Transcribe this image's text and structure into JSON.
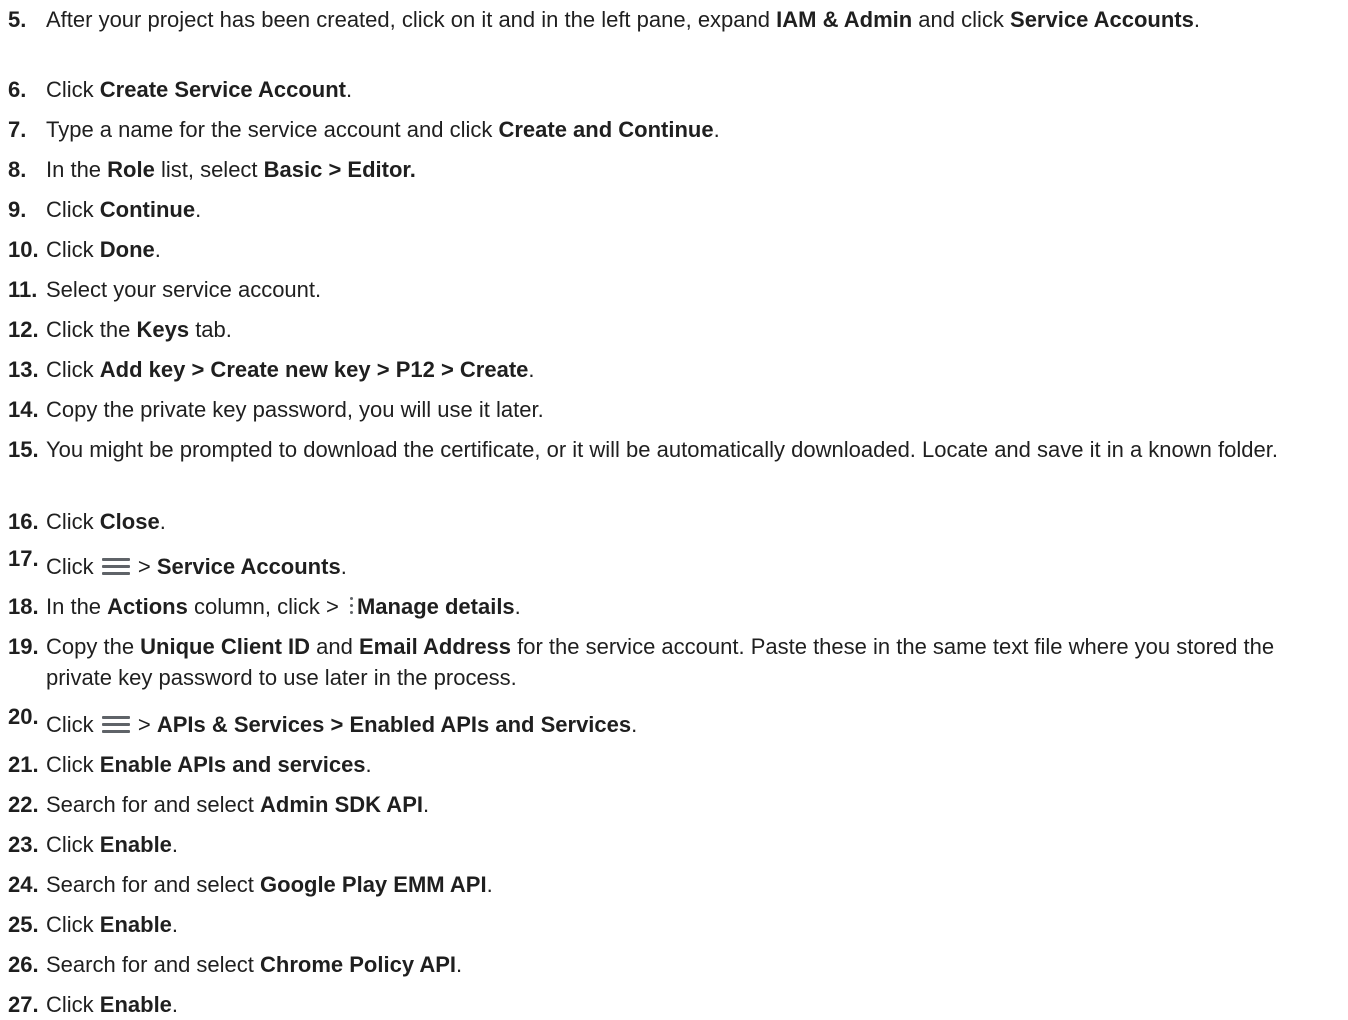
{
  "steps": [
    {
      "num": "5.",
      "parts": [
        {
          "t": "After your project has been created, click on it and in the left pane, expand "
        },
        {
          "t": "IAM & Admin",
          "b": true
        },
        {
          "t": " and click "
        },
        {
          "t": "Service Accounts",
          "b": true
        },
        {
          "t": "."
        }
      ]
    },
    {
      "num": "6.",
      "parts": [
        {
          "t": "Click "
        },
        {
          "t": "Create Service Account",
          "b": true
        },
        {
          "t": "."
        }
      ]
    },
    {
      "num": "7.",
      "parts": [
        {
          "t": "Type a name for the service account and click "
        },
        {
          "t": "Create and Continue",
          "b": true
        },
        {
          "t": "."
        }
      ]
    },
    {
      "num": "8.",
      "parts": [
        {
          "t": "In the "
        },
        {
          "t": "Role",
          "b": true
        },
        {
          "t": " list, select "
        },
        {
          "t": "Basic > Editor.",
          "b": true
        }
      ]
    },
    {
      "num": "9.",
      "parts": [
        {
          "t": "Click "
        },
        {
          "t": "Continue",
          "b": true
        },
        {
          "t": "."
        }
      ]
    },
    {
      "num": "10.",
      "parts": [
        {
          "t": "Click "
        },
        {
          "t": "Done",
          "b": true
        },
        {
          "t": "."
        }
      ]
    },
    {
      "num": "11.",
      "parts": [
        {
          "t": "Select your service account."
        }
      ]
    },
    {
      "num": "12.",
      "parts": [
        {
          "t": "Click the "
        },
        {
          "t": "Keys",
          "b": true
        },
        {
          "t": " tab."
        }
      ]
    },
    {
      "num": "13.",
      "parts": [
        {
          "t": "Click "
        },
        {
          "t": "Add key > Create new key > P12 > Create",
          "b": true
        },
        {
          "t": "."
        }
      ]
    },
    {
      "num": "14.",
      "parts": [
        {
          "t": "Copy the private key password, you will use it later."
        }
      ]
    },
    {
      "num": "15.",
      "parts": [
        {
          "t": "You might be prompted to download the certificate, or it will be automatically downloaded. Locate and save it in a known folder."
        }
      ]
    },
    {
      "num": "16.",
      "parts": [
        {
          "t": "Click "
        },
        {
          "t": "Close",
          "b": true
        },
        {
          "t": "."
        }
      ]
    },
    {
      "num": "17.",
      "raised": true,
      "parts": [
        {
          "t": "Click "
        },
        {
          "icon": "menu-icon"
        },
        {
          "t": " > "
        },
        {
          "t": "Service Accounts",
          "b": true
        },
        {
          "t": "."
        }
      ]
    },
    {
      "num": "18.",
      "parts": [
        {
          "t": "In the "
        },
        {
          "t": "Actions",
          "b": true
        },
        {
          "t": " column, click > "
        },
        {
          "icon": "more-vert-icon"
        },
        {
          "t": "Manage details",
          "b": true
        },
        {
          "t": "."
        }
      ]
    },
    {
      "num": "19.",
      "parts": [
        {
          "t": "Copy the "
        },
        {
          "t": "Unique Client ID",
          "b": true
        },
        {
          "t": " and "
        },
        {
          "t": "Email Address",
          "b": true
        },
        {
          "t": " for the service account. Paste these in the same text file where you stored the private key password to use later in the process."
        }
      ]
    },
    {
      "num": "20.",
      "raised": true,
      "parts": [
        {
          "t": "Click "
        },
        {
          "icon": "menu-icon"
        },
        {
          "t": " > "
        },
        {
          "t": "APIs & Services > Enabled APIs and Services",
          "b": true
        },
        {
          "t": "."
        }
      ]
    },
    {
      "num": "21.",
      "parts": [
        {
          "t": "Click "
        },
        {
          "t": "Enable APIs and services",
          "b": true
        },
        {
          "t": "."
        }
      ]
    },
    {
      "num": "22.",
      "parts": [
        {
          "t": "Search for and select "
        },
        {
          "t": "Admin SDK API",
          "b": true
        },
        {
          "t": "."
        }
      ]
    },
    {
      "num": "23.",
      "parts": [
        {
          "t": "Click "
        },
        {
          "t": "Enable",
          "b": true
        },
        {
          "t": "."
        }
      ]
    },
    {
      "num": "24.",
      "parts": [
        {
          "t": "Search for and select "
        },
        {
          "t": "Google Play EMM API",
          "b": true
        },
        {
          "t": "."
        }
      ]
    },
    {
      "num": "25.",
      "parts": [
        {
          "t": "Click "
        },
        {
          "t": "Enable",
          "b": true
        },
        {
          "t": "."
        }
      ]
    },
    {
      "num": "26.",
      "parts": [
        {
          "t": "Search for and select "
        },
        {
          "t": "Chrome Policy API",
          "b": true
        },
        {
          "t": "."
        }
      ]
    },
    {
      "num": "27.",
      "parts": [
        {
          "t": "Click "
        },
        {
          "t": "Enable",
          "b": true
        },
        {
          "t": "."
        }
      ]
    }
  ]
}
